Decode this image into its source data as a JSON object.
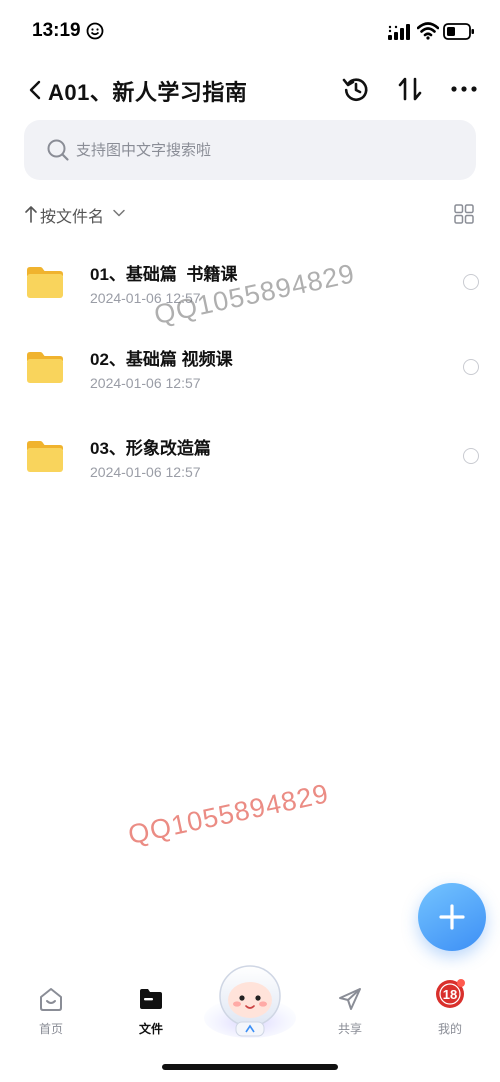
{
  "status_bar": {
    "time": "13:19"
  },
  "nav": {
    "title": "A01、新人学习指南"
  },
  "search": {
    "placeholder": "支持图中文字搜索啦"
  },
  "sort": {
    "label": "按文件名"
  },
  "files": [
    {
      "name": "01、基础篇  书籍课",
      "date": "2024-01-06 12:57",
      "icon": "folder-icon"
    },
    {
      "name": "02、基础篇 视频课",
      "date": "2024-01-06 12:57",
      "icon": "folder-icon"
    },
    {
      "name": "03、形象改造篇",
      "date": "2024-01-06 12:57",
      "icon": "folder-icon"
    }
  ],
  "watermarks": [
    "QQ1055894829",
    "QQ1055894829"
  ],
  "tabs": [
    {
      "label": "首页",
      "icon": "home-icon",
      "active": false
    },
    {
      "label": "文件",
      "icon": "folder-icon",
      "active": true
    },
    {
      "label": "共享",
      "icon": "send-icon",
      "active": false
    },
    {
      "label": "我的",
      "icon": "avatar-icon",
      "active": false
    }
  ],
  "colors": {
    "accent": "#3d8ff5",
    "folder": "#f7c948",
    "search_bg": "#f1f2f6",
    "watermark_red": "#e8786e"
  }
}
